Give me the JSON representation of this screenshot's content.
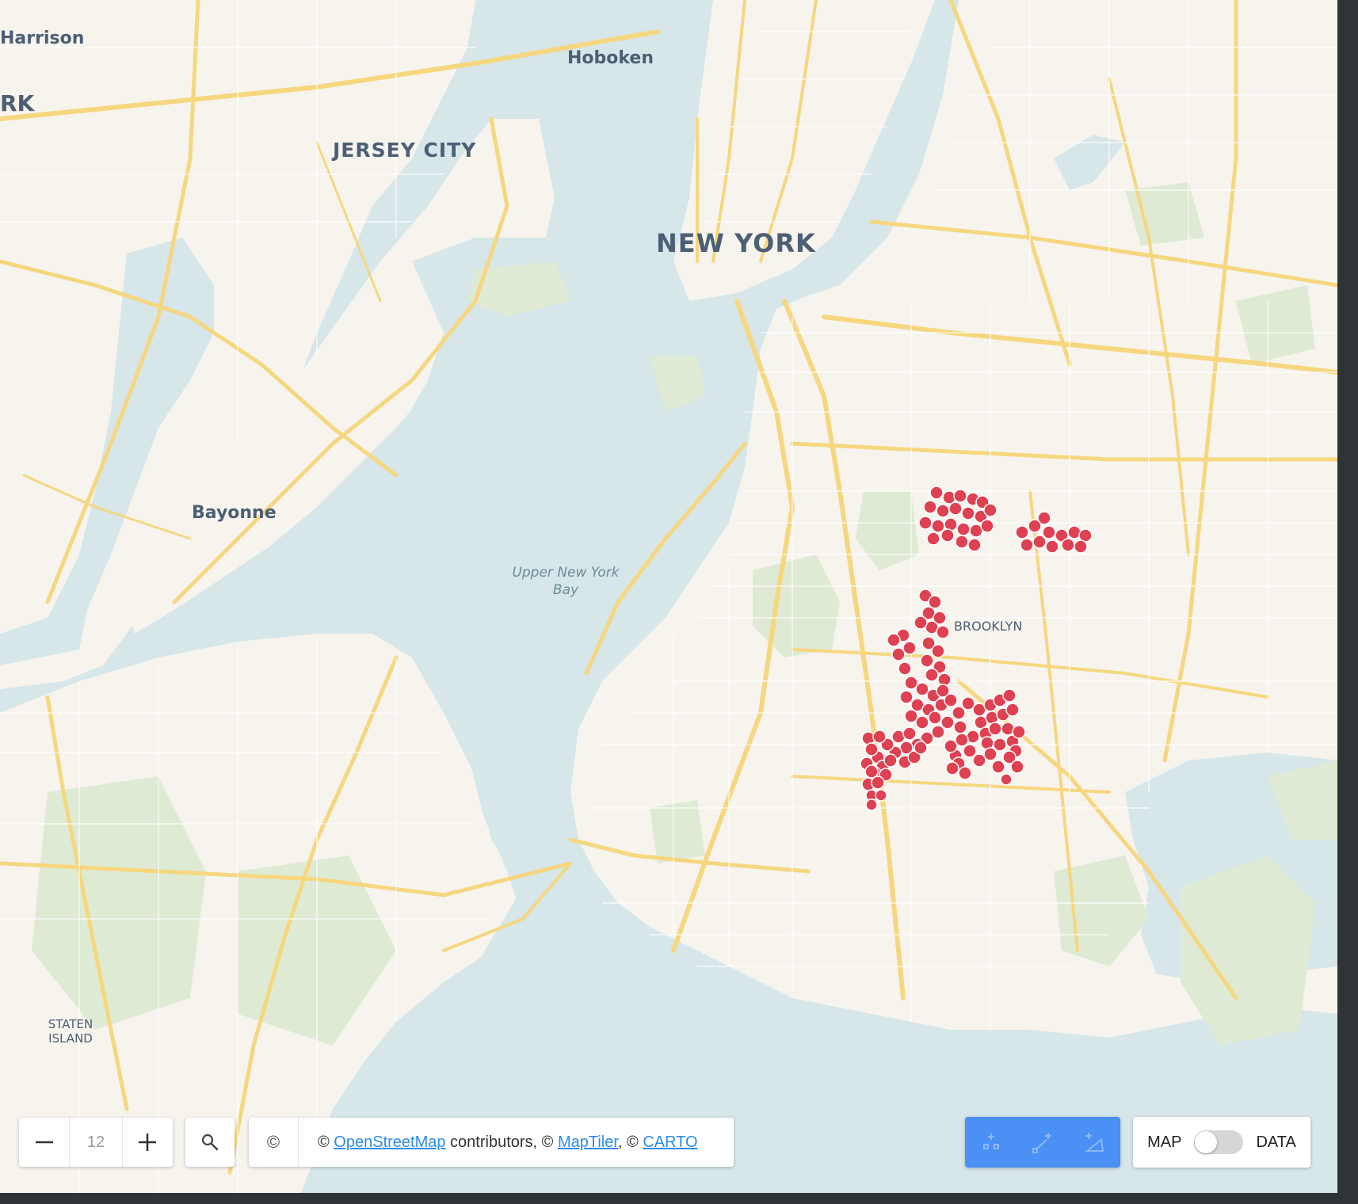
{
  "map": {
    "places": {
      "harrison": "Harrison",
      "newark_fragment": "RK",
      "hoboken": "Hoboken",
      "jersey_city": "JERSEY CITY",
      "new_york": "NEW YORK",
      "bayonne": "Bayonne",
      "bay_line1": "Upper New York",
      "bay_line2": "Bay",
      "brooklyn": "BROOKLYN",
      "staten_line1": "STATEN",
      "staten_line2": "ISLAND"
    },
    "colors": {
      "water": "#d6e6e9",
      "land": "#f7f4ee",
      "park": "#deead4",
      "road": "#f6d77f",
      "points": "#de4152"
    },
    "data_layer": "red point markers clustered in central Brooklyn"
  },
  "controls": {
    "zoom": {
      "out_icon": "minus-icon",
      "level": "12",
      "in_icon": "plus-icon"
    },
    "search_icon": "search-icon",
    "attribution": {
      "copyright": "©",
      "prefix": "© ",
      "osm": "OpenStreetMap",
      "mid1": " contributors, © ",
      "maptiler": "MapTiler",
      "mid2": ", © ",
      "carto": "CARTO"
    },
    "draw_tools": [
      "draw-point-icon",
      "draw-line-icon",
      "draw-polygon-icon"
    ],
    "mode": {
      "left": "MAP",
      "right": "DATA",
      "data_enabled": false
    }
  }
}
